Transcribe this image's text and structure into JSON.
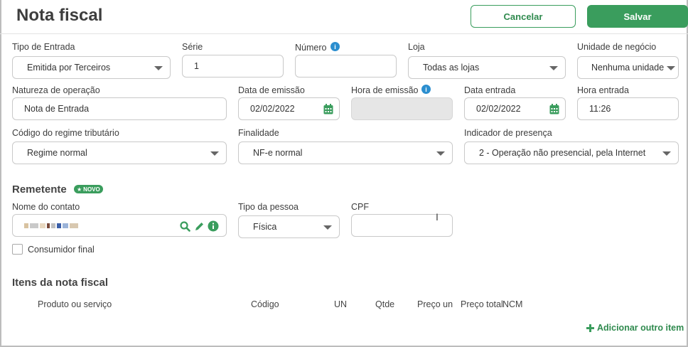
{
  "header": {
    "title": "Nota fiscal",
    "cancel_label": "Cancelar",
    "save_label": "Salvar"
  },
  "row1": {
    "tipo_entrada": {
      "label": "Tipo de Entrada",
      "value": "Emitida por Terceiros"
    },
    "serie": {
      "label": "Série",
      "value": "1"
    },
    "numero": {
      "label": "Número",
      "value": ""
    },
    "loja": {
      "label": "Loja",
      "value": "Todas as lojas"
    },
    "unidade": {
      "label": "Unidade de negócio",
      "value": "Nenhuma unidade"
    }
  },
  "row2": {
    "natureza": {
      "label": "Natureza de operação",
      "value": "Nota de Entrada"
    },
    "data_emissao": {
      "label": "Data de emissão",
      "value": "02/02/2022"
    },
    "hora_emissao": {
      "label": "Hora de emissão",
      "value": ""
    },
    "data_entrada": {
      "label": "Data entrada",
      "value": "02/02/2022"
    },
    "hora_entrada": {
      "label": "Hora entrada",
      "value": "11:26"
    }
  },
  "row3": {
    "regime": {
      "label": "Código do regime tributário",
      "value": "Regime normal"
    },
    "finalidade": {
      "label": "Finalidade",
      "value": "NF-e normal"
    },
    "presenca": {
      "label": "Indicador de presença",
      "value": "2 - Operação não presencial, pela Internet"
    }
  },
  "remetente": {
    "title": "Remetente",
    "badge": "NOVO",
    "nome_label": "Nome do contato",
    "tipo_pessoa_label": "Tipo da pessoa",
    "tipo_pessoa_value": "Física",
    "cpf_label": "CPF",
    "cpf_value": "",
    "consumidor_label": "Consumidor final"
  },
  "itens": {
    "title": "Itens da nota fiscal",
    "columns": [
      "Produto ou serviço",
      "Código",
      "UN",
      "Qtde",
      "Preço un",
      "Preço total",
      "NCM"
    ],
    "add_label": "Adicionar outro item"
  },
  "colors": {
    "accent": "#3a9d5d",
    "info": "#2b8ecf"
  },
  "icons": [
    "info-icon",
    "calendar-icon",
    "search-icon",
    "pencil-icon",
    "plus-icon",
    "star-icon"
  ]
}
